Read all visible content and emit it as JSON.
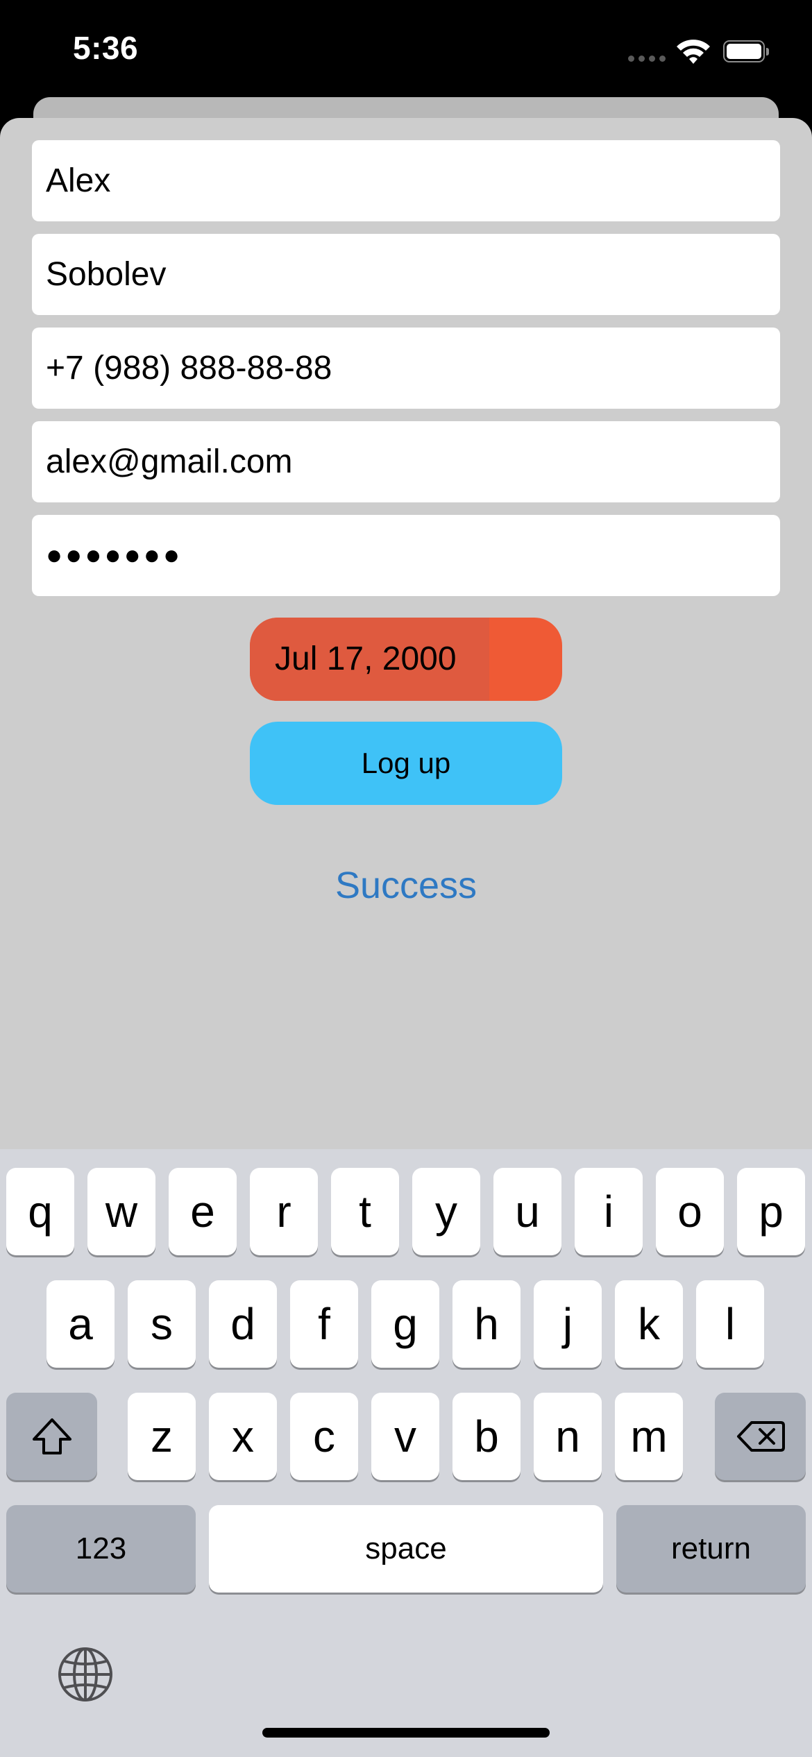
{
  "status_bar": {
    "time": "5:36"
  },
  "form": {
    "first_name": "Alex",
    "last_name": "Sobolev",
    "phone": "+7 (988) 888-88-88",
    "email": "alex@gmail.com",
    "password_masked": "●●●●●●●",
    "date": "Jul 17, 2000",
    "logup_label": "Log up",
    "status_message": "Success"
  },
  "colors": {
    "date_button": "#ef5a35",
    "logup_button": "#3fc2f7",
    "success_text": "#2e79c3",
    "sheet_background": "#cdcdcd"
  },
  "keyboard": {
    "row1": [
      "q",
      "w",
      "e",
      "r",
      "t",
      "y",
      "u",
      "i",
      "o",
      "p"
    ],
    "row2": [
      "a",
      "s",
      "d",
      "f",
      "g",
      "h",
      "j",
      "k",
      "l"
    ],
    "row3": [
      "z",
      "x",
      "c",
      "v",
      "b",
      "n",
      "m"
    ],
    "numbers_label": "123",
    "space_label": "space",
    "return_label": "return",
    "icons": [
      "shift-icon",
      "delete-icon",
      "globe-icon"
    ]
  }
}
